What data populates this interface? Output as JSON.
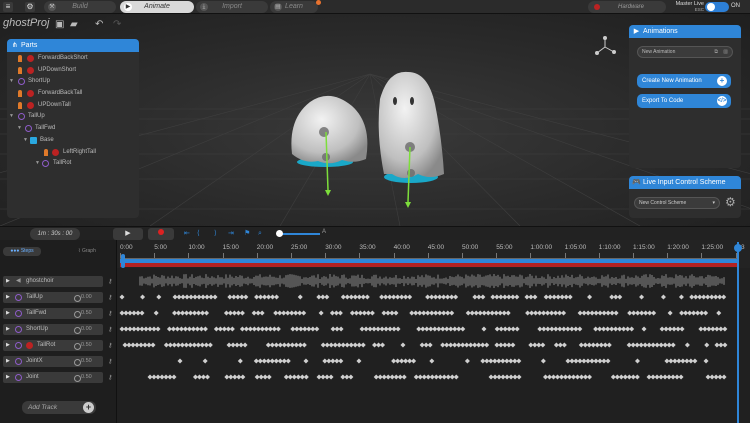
{
  "topbar": {
    "tabs": [
      {
        "label": "Build",
        "icon": "hammer-icon"
      },
      {
        "label": "Animate",
        "icon": "play-icon"
      },
      {
        "label": "Import",
        "icon": "download-icon"
      },
      {
        "label": "Learn",
        "icon": "book-icon"
      }
    ],
    "active_tab": "Animate",
    "hardware_label": "Hardware",
    "master_live_label": "Master Live",
    "master_live_sub": "ESC",
    "toggle_label": "ON",
    "toggle_on": true
  },
  "project": {
    "title": "ghostProj"
  },
  "parts_panel": {
    "title": "Parts",
    "items": [
      {
        "label": "ForwardBackShort",
        "type": "bone",
        "depth": 1
      },
      {
        "label": "UPDownShort",
        "type": "bone",
        "depth": 1
      },
      {
        "label": "ShortUp",
        "type": "motor",
        "depth": 0
      },
      {
        "label": "ForwardBackTall",
        "type": "bone",
        "depth": 1
      },
      {
        "label": "UPDownTall",
        "type": "bone",
        "depth": 1
      },
      {
        "label": "TallUp",
        "type": "motor",
        "depth": 0
      },
      {
        "label": "TallFwd",
        "type": "motor",
        "depth": 1
      },
      {
        "label": "Base",
        "type": "joint",
        "depth": 2
      },
      {
        "label": "LeftRightTall",
        "type": "bone",
        "depth": 3
      },
      {
        "label": "TallRot",
        "type": "motor",
        "depth": 3
      }
    ]
  },
  "animations_panel": {
    "title": "Animations",
    "current": "New Animation",
    "create_label": "Create New Animation",
    "export_label": "Export To Code"
  },
  "input_panel": {
    "title": "Live Input Control Scheme",
    "current": "New Control Scheme"
  },
  "transport": {
    "timecode": "1m : 30s : 00"
  },
  "zoom_label": "A",
  "view_tabs": {
    "active": "Steps",
    "other": "Graph"
  },
  "ruler": [
    "0:00",
    "5:00",
    "10:00",
    "15:00",
    "20:00",
    "25:00",
    "30:00",
    "35:00",
    "40:00",
    "45:00",
    "50:00",
    "55:00",
    "1:00:00",
    "1:05:00",
    "1:10:00",
    "1:15:00",
    "1:20:00",
    "1:25:00",
    "1:3"
  ],
  "tracks": [
    {
      "label": "ghostchoir",
      "value": "",
      "kind": "audio"
    },
    {
      "label": "TallUp",
      "value": "0.00",
      "kind": "motor"
    },
    {
      "label": "TallFwd",
      "value": "0.50",
      "kind": "motor"
    },
    {
      "label": "ShortUp",
      "value": "0.00",
      "kind": "motor"
    },
    {
      "label": "TallRot",
      "value": "0.50",
      "kind": "motor"
    },
    {
      "label": "JointX",
      "value": "0.50",
      "kind": "motor"
    },
    {
      "label": "Joint",
      "value": "0.50",
      "kind": "motor"
    }
  ],
  "add_track_label": "Add Track",
  "colors": {
    "accent": "#2f86d8",
    "record": "#b22222",
    "notify": "#e8722e",
    "motor": "#8e5cc9",
    "vector": "#7dde3b"
  }
}
